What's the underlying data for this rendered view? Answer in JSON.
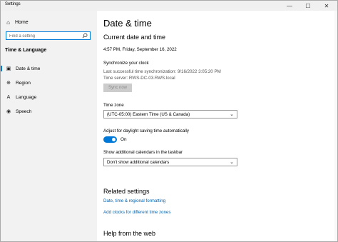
{
  "window": {
    "title": "Settings",
    "controls": {
      "minimize": "—",
      "maximize": "☐",
      "close": "✕"
    }
  },
  "sidebar": {
    "home": {
      "label": "Home",
      "icon": "home-icon"
    },
    "search": {
      "placeholder": "Find a setting",
      "value": ""
    },
    "section_title": "Time & Language",
    "items": [
      {
        "label": "Date & time",
        "icon": "calendar-clock-icon",
        "active": true
      },
      {
        "label": "Region",
        "icon": "globe-icon",
        "active": false
      },
      {
        "label": "Language",
        "icon": "language-icon",
        "active": false
      },
      {
        "label": "Speech",
        "icon": "microphone-icon",
        "active": false
      }
    ]
  },
  "main": {
    "page_title": "Date & time",
    "current_heading": "Current date and time",
    "current_datetime": "4:57 PM, Friday, September 16, 2022",
    "sync": {
      "heading": "Synchronize your clock",
      "last_sync": "Last successful time synchronization: 9/16/2022 3:05:20 PM",
      "time_server": "Time server: RWS-DC-03.RWS.local",
      "button_label": "Sync now"
    },
    "time_zone": {
      "label": "Time zone",
      "selected": "(UTC-05:00) Eastern Time (US & Canada)"
    },
    "daylight": {
      "label": "Adjust for daylight saving time automatically",
      "state": "On"
    },
    "calendars": {
      "label": "Show additional calendars in the taskbar",
      "selected": "Don't show additional calendars"
    },
    "related": {
      "heading": "Related settings",
      "links": [
        "Date, time & regional formatting",
        "Add clocks for different time zones"
      ]
    },
    "help_heading": "Help from the web"
  },
  "colors": {
    "accent": "#0078d7",
    "link": "#0063b1",
    "sidebar_bg": "#f2f2f2"
  }
}
